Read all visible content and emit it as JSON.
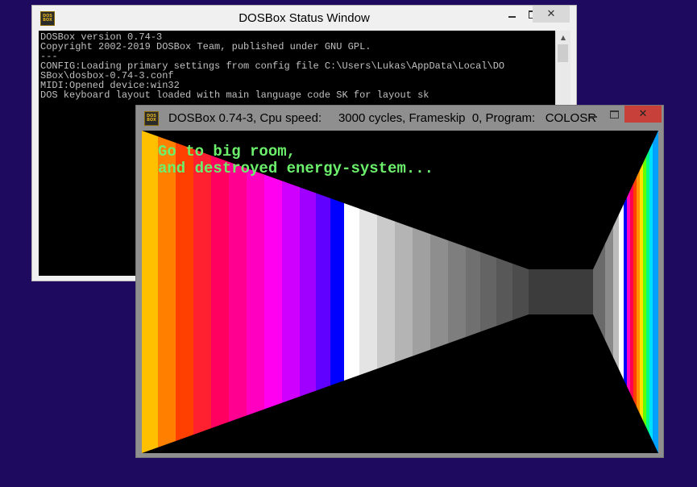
{
  "status_window": {
    "title": "DOSBox Status Window",
    "icon_text_top": "DOS",
    "icon_text_bottom": "BOX",
    "console_lines": [
      "DOSBox version 0.74-3",
      "Copyright 2002-2019 DOSBox Team, published under GNU GPL.",
      "---",
      "CONFIG:Loading primary settings from config file C:\\Users\\Lukas\\AppData\\Local\\DO",
      "SBox\\dosbox-0.74-3.conf",
      "MIDI:Opened device:win32",
      "DOS keyboard layout loaded with main language code SK for layout sk"
    ]
  },
  "game_window": {
    "title": "DOSBox 0.74-3, Cpu speed:     3000 cycles, Frameskip  0, Program:   COLOSR",
    "icon_text_top": "DOS",
    "icon_text_bottom": "BOX",
    "game_text_line1": "Go to big room,",
    "game_text_line2": "and destroyed energy-system..."
  },
  "controls": {
    "close_symbol": "✕"
  },
  "colors": {
    "desktop": "#1e0a5e",
    "game_text": "#6cf06c",
    "close_button": "#c7413a"
  }
}
